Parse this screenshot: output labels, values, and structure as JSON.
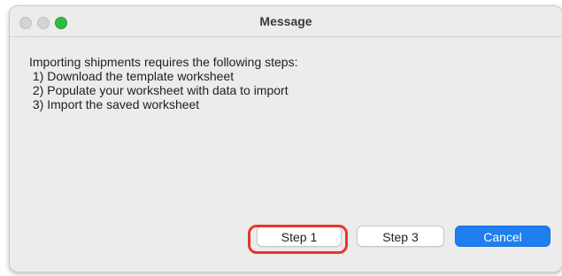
{
  "window": {
    "title": "Message"
  },
  "traffic_lights": {
    "close": "close-button",
    "minimize": "minimize-button",
    "zoom": "zoom-button",
    "zoom_color": "#2bbd3f"
  },
  "message": {
    "lines": [
      "Importing shipments requires the following steps:",
      " 1) Download the template worksheet",
      " 2) Populate your worksheet with data to import",
      " 3) Import the saved worksheet"
    ]
  },
  "buttons": {
    "step1": "Step 1",
    "step3": "Step 3",
    "cancel": "Cancel"
  },
  "colors": {
    "primary": "#1f7ff0",
    "highlight": "#e8362a"
  }
}
